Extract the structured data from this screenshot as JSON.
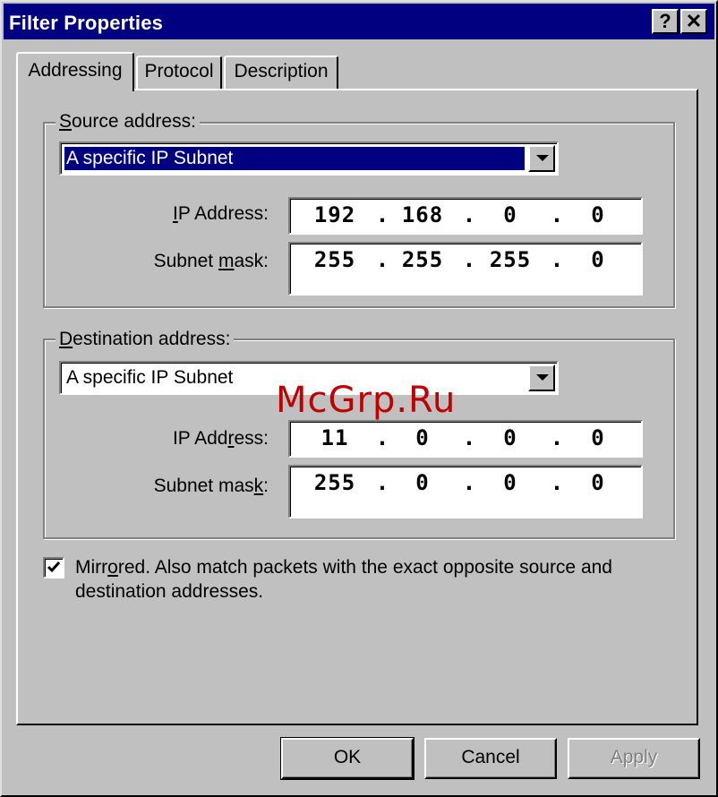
{
  "window": {
    "title": "Filter Properties",
    "help_glyph": "?",
    "close_glyph": "✕"
  },
  "tabs": [
    {
      "label": "Addressing",
      "selected": true
    },
    {
      "label": "Protocol",
      "selected": false
    },
    {
      "label": "Description",
      "selected": false
    }
  ],
  "source": {
    "legend_pre": "",
    "legend_mnemonic": "S",
    "legend_post": "ource address:",
    "type_value": "A specific IP Subnet",
    "ip_label_pre": "",
    "ip_label_mnemonic": "I",
    "ip_label_post": "P Address:",
    "mask_label_pre": "Subnet ",
    "mask_label_mnemonic": "m",
    "mask_label_post": "ask:",
    "ip": [
      "192",
      "168",
      "0",
      "0"
    ],
    "mask": [
      "255",
      "255",
      "255",
      "0"
    ]
  },
  "destination": {
    "legend_pre": "",
    "legend_mnemonic": "D",
    "legend_post": "estination address:",
    "type_value": "A specific IP Subnet",
    "ip_label_pre": "IP Add",
    "ip_label_mnemonic": "r",
    "ip_label_post": "ess:",
    "mask_label_pre": "Subnet mas",
    "mask_label_mnemonic": "k",
    "mask_label_post": ":",
    "ip": [
      "11",
      "0",
      "0",
      "0"
    ],
    "mask": [
      "255",
      "0",
      "0",
      "0"
    ]
  },
  "mirrored": {
    "checked": true,
    "label_pre": "Mirr",
    "label_mnemonic": "o",
    "label_post": "red. Also match packets with the exact opposite source and destination addresses."
  },
  "watermark": "McGrp.Ru",
  "buttons": {
    "ok": "OK",
    "cancel": "Cancel",
    "apply": "Apply"
  },
  "ip_separator": "."
}
